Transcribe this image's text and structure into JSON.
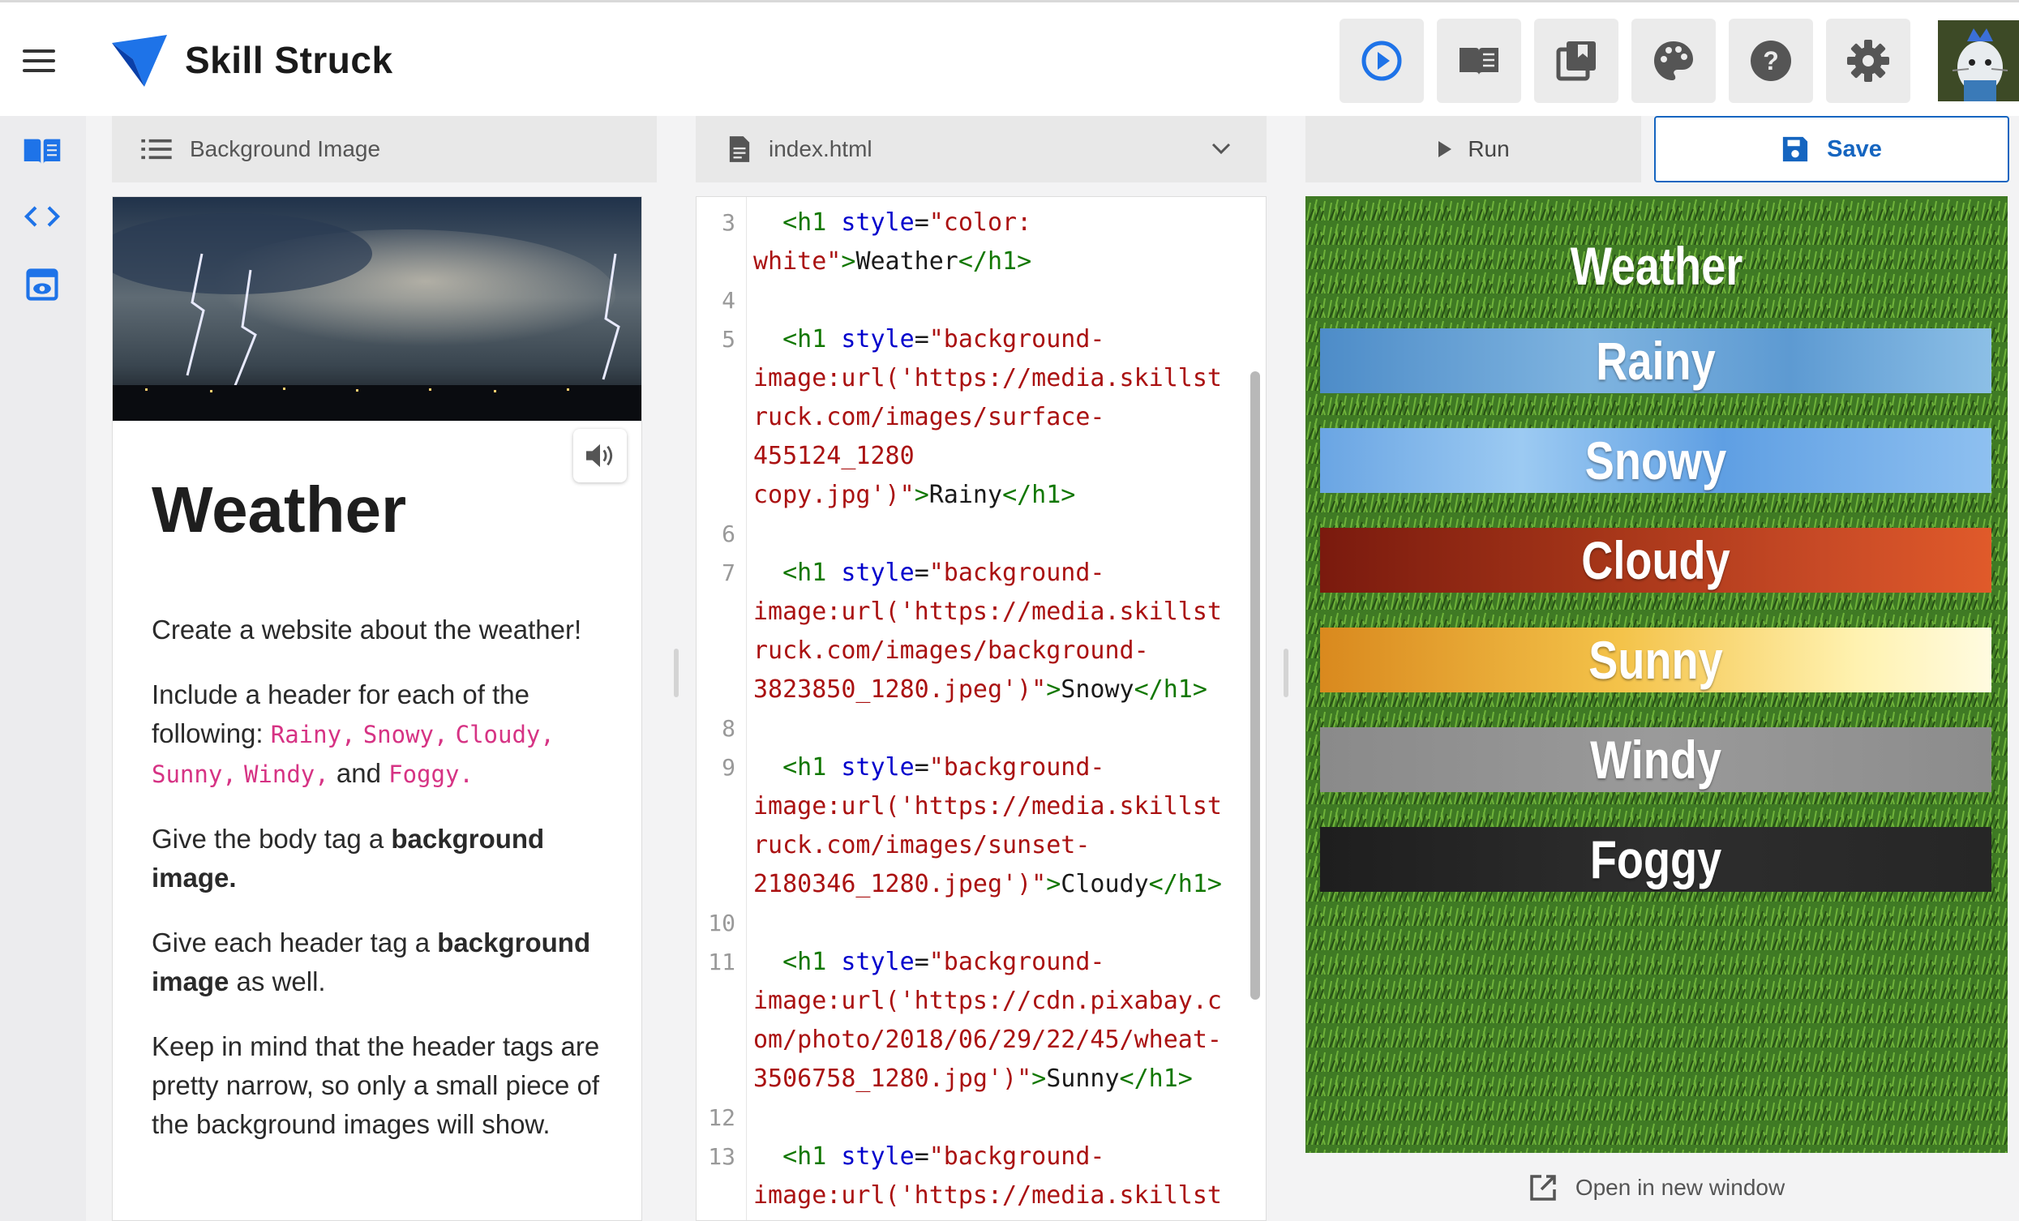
{
  "app": {
    "brand": "Skill Struck"
  },
  "toolbar": {
    "icons": [
      "play-circle-icon",
      "book-icon",
      "library-icon",
      "palette-icon",
      "help-icon",
      "gear-icon"
    ],
    "accent": "#1e73e8"
  },
  "rail": {
    "items": [
      "book-icon",
      "code-icon",
      "preview-icon"
    ]
  },
  "lesson": {
    "header": "Background Image",
    "title": "Weather",
    "p1": "Create a website about the weather!",
    "p2_a": "Include a header for each of the following: ",
    "p2_codes": [
      "Rainy,",
      "Snowy,",
      "Cloudy,",
      "Sunny,",
      "Windy,"
    ],
    "p2_and": " and ",
    "p2_last": "Foggy.",
    "p3_a": "Give the body tag a ",
    "p3_b": "background image.",
    "p4_a": "Give each header tag a ",
    "p4_b": "background image",
    "p4_c": " as well.",
    "p5": "Keep in mind that the header tags are pretty narrow, so only a small piece of the background images will show."
  },
  "editor": {
    "file": "index.html",
    "lines": [
      {
        "n": "3",
        "parts": [
          [
            "",
            "  "
          ],
          [
            "tag",
            "<h1"
          ],
          [
            "",
            " "
          ],
          [
            "attr",
            "style"
          ],
          [
            "",
            "="
          ],
          [
            "str",
            "\"color:"
          ]
        ]
      },
      {
        "n": "",
        "parts": [
          [
            "str",
            "white\""
          ],
          [
            "tag",
            ">"
          ],
          [
            "",
            "Weather"
          ],
          [
            "tag",
            "</h1>"
          ]
        ]
      },
      {
        "n": "4",
        "parts": []
      },
      {
        "n": "5",
        "parts": [
          [
            "",
            "  "
          ],
          [
            "tag",
            "<h1"
          ],
          [
            "",
            " "
          ],
          [
            "attr",
            "style"
          ],
          [
            "",
            "="
          ],
          [
            "str",
            "\"background-"
          ]
        ]
      },
      {
        "n": "",
        "parts": [
          [
            "str",
            "image:url('https://media.skillst"
          ]
        ]
      },
      {
        "n": "",
        "parts": [
          [
            "str",
            "ruck.com/images/surface-"
          ]
        ]
      },
      {
        "n": "",
        "parts": [
          [
            "str",
            "455124_1280"
          ]
        ]
      },
      {
        "n": "",
        "parts": [
          [
            "str",
            "copy.jpg')\""
          ],
          [
            "tag",
            ">"
          ],
          [
            "",
            "Rainy"
          ],
          [
            "tag",
            "</h1>"
          ]
        ]
      },
      {
        "n": "6",
        "parts": []
      },
      {
        "n": "7",
        "parts": [
          [
            "",
            "  "
          ],
          [
            "tag",
            "<h1"
          ],
          [
            "",
            " "
          ],
          [
            "attr",
            "style"
          ],
          [
            "",
            "="
          ],
          [
            "str",
            "\"background-"
          ]
        ]
      },
      {
        "n": "",
        "parts": [
          [
            "str",
            "image:url('https://media.skillst"
          ]
        ]
      },
      {
        "n": "",
        "parts": [
          [
            "str",
            "ruck.com/images/background-"
          ]
        ]
      },
      {
        "n": "",
        "parts": [
          [
            "str",
            "3823850_1280.jpeg')\""
          ],
          [
            "tag",
            ">"
          ],
          [
            "",
            "Snowy"
          ],
          [
            "tag",
            "</h1>"
          ]
        ]
      },
      {
        "n": "8",
        "parts": []
      },
      {
        "n": "9",
        "parts": [
          [
            "",
            "  "
          ],
          [
            "tag",
            "<h1"
          ],
          [
            "",
            " "
          ],
          [
            "attr",
            "style"
          ],
          [
            "",
            "="
          ],
          [
            "str",
            "\"background-"
          ]
        ]
      },
      {
        "n": "",
        "parts": [
          [
            "str",
            "image:url('https://media.skillst"
          ]
        ]
      },
      {
        "n": "",
        "parts": [
          [
            "str",
            "ruck.com/images/sunset-"
          ]
        ]
      },
      {
        "n": "",
        "parts": [
          [
            "str",
            "2180346_1280.jpeg')\""
          ],
          [
            "tag",
            ">"
          ],
          [
            "",
            "Cloudy"
          ],
          [
            "tag",
            "</h1>"
          ]
        ]
      },
      {
        "n": "10",
        "parts": []
      },
      {
        "n": "11",
        "parts": [
          [
            "",
            "  "
          ],
          [
            "tag",
            "<h1"
          ],
          [
            "",
            " "
          ],
          [
            "attr",
            "style"
          ],
          [
            "",
            "="
          ],
          [
            "str",
            "\"background-"
          ]
        ]
      },
      {
        "n": "",
        "parts": [
          [
            "str",
            "image:url('https://cdn.pixabay.c"
          ]
        ]
      },
      {
        "n": "",
        "parts": [
          [
            "str",
            "om/photo/2018/06/29/22/45/wheat-"
          ]
        ]
      },
      {
        "n": "",
        "parts": [
          [
            "str",
            "3506758_1280.jpg')\""
          ],
          [
            "tag",
            ">"
          ],
          [
            "",
            "Sunny"
          ],
          [
            "tag",
            "</h1>"
          ]
        ]
      },
      {
        "n": "12",
        "parts": []
      },
      {
        "n": "13",
        "parts": [
          [
            "",
            "  "
          ],
          [
            "tag",
            "<h1"
          ],
          [
            "",
            " "
          ],
          [
            "attr",
            "style"
          ],
          [
            "",
            "="
          ],
          [
            "str",
            "\"background-"
          ]
        ]
      },
      {
        "n": "",
        "parts": [
          [
            "str",
            "image:url('https://media.skillst"
          ]
        ]
      }
    ]
  },
  "actions": {
    "run": "Run",
    "save": "Save",
    "open_new": "Open in new window"
  },
  "preview": {
    "title": "Weather",
    "bands": [
      {
        "label": "Rainy",
        "bg": "linear-gradient(90deg,#4d8cc8,#7fb4e0 40%,#5d9ad2 70%,#8cbfe6)"
      },
      {
        "label": "Snowy",
        "bg": "linear-gradient(90deg,#6aa5e3,#9ccaf2 30%,#5f9fe3 60%,#8ec0f0)"
      },
      {
        "label": "Cloudy",
        "bg": "linear-gradient(90deg,#7a1a0e,#a33418 40%,#c84a26 75%,#e05a2a)"
      },
      {
        "label": "Sunny",
        "bg": "linear-gradient(90deg,#d9891e,#f4c34a 45%,#fff2b0 80%,#fffbe0)"
      },
      {
        "label": "Windy",
        "bg": "linear-gradient(90deg,#8a8a8a,#9a9a9a 50%,#8c8c8c)"
      },
      {
        "label": "Foggy",
        "bg": "linear-gradient(90deg,#1e1e1e,#2e2e2e 50%,#262626)"
      }
    ]
  }
}
